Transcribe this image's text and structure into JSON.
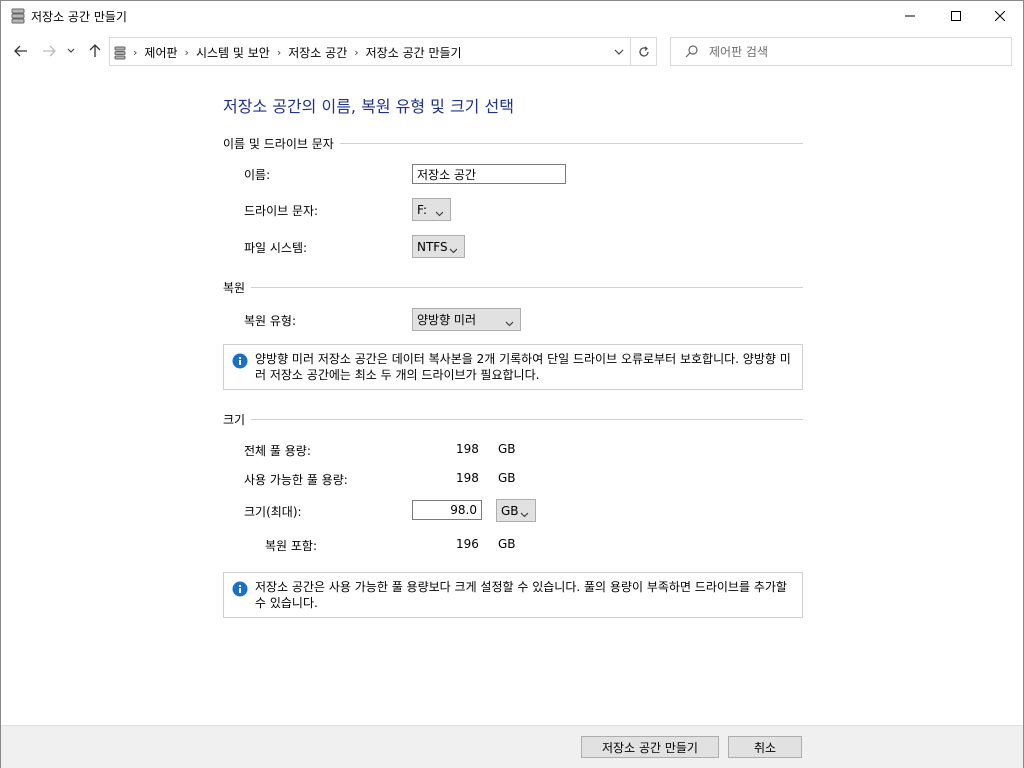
{
  "window": {
    "title": "저장소 공간 만들기",
    "minimize_icon": "minimize-icon",
    "maximize_icon": "maximize-icon",
    "close_icon": "close-icon"
  },
  "nav": {
    "breadcrumbs": [
      "제어판",
      "시스템 및 보안",
      "저장소 공간",
      "저장소 공간 만들기"
    ],
    "search_placeholder": "제어판 검색"
  },
  "page": {
    "title": "저장소 공간의 이름, 복원 유형 및 크기 선택"
  },
  "name_section": {
    "header": "이름 및 드라이브 문자",
    "name_label": "이름:",
    "name_value": "저장소 공간",
    "drive_letter_label": "드라이브 문자:",
    "drive_letter_value": "F:",
    "filesystem_label": "파일 시스템:",
    "filesystem_value": "NTFS"
  },
  "resiliency_section": {
    "header": "복원",
    "type_label": "복원 유형:",
    "type_value": "양방향 미러",
    "info_text": "양방향 미러 저장소 공간은 데이터 복사본을 2개 기록하여 단일 드라이브 오류로부터 보호합니다. 양방향 미러 저장소 공간에는 최소 두 개의 드라이브가 필요합니다."
  },
  "size_section": {
    "header": "크기",
    "total_pool_label": "전체 풀 용량:",
    "total_pool_value": "198",
    "total_pool_unit": "GB",
    "available_pool_label": "사용 가능한 풀 용량:",
    "available_pool_value": "198",
    "available_pool_unit": "GB",
    "size_label": "크기(최대):",
    "size_value": "98.0",
    "size_unit": "GB",
    "including_resiliency_label": "복원 포함:",
    "including_resiliency_value": "196",
    "including_resiliency_unit": "GB",
    "info_text": "저장소 공간은 사용 가능한 풀 용량보다 크게 설정할 수 있습니다. 풀의 용량이 부족하면 드라이브를 추가할 수 있습니다."
  },
  "footer": {
    "create_label": "저장소 공간 만들기",
    "cancel_label": "취소"
  },
  "colors": {
    "title_blue": "#1e3287",
    "info_blue": "#1a6fc9",
    "button_face": "#e1e1e1",
    "footer_bg": "#f0f0f0"
  }
}
